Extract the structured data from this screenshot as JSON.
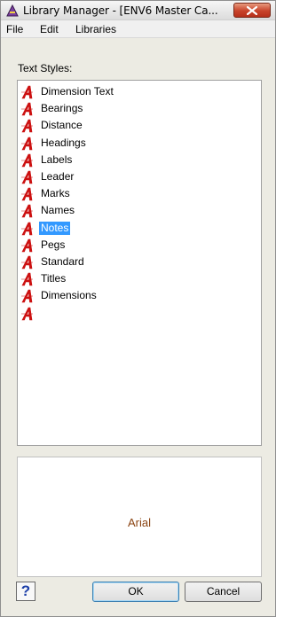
{
  "window": {
    "title": "Library Manager - [ENV6 Master Ca...",
    "icon": "library-manager-icon",
    "close_icon": "close-icon"
  },
  "menu": [
    "File",
    "Edit",
    "Libraries"
  ],
  "text_styles": {
    "label": "Text Styles:",
    "item_icon": "text-style-a-icon",
    "items": [
      "Dimension Text",
      "Bearings",
      "Distance",
      "Headings",
      "Labels",
      "Leader",
      "Marks",
      "Names",
      "Notes",
      "Pegs",
      "Standard",
      "Titles",
      "Dimensions",
      ""
    ],
    "selected": "Notes"
  },
  "preview": {
    "font_name": "Arial",
    "color": "#8b4513"
  },
  "buttons": {
    "help": "?",
    "ok": "OK",
    "cancel": "Cancel"
  },
  "colors": {
    "selection": "#3399ff",
    "icon_red": "#cc1111",
    "close_red": "#c8432a"
  }
}
